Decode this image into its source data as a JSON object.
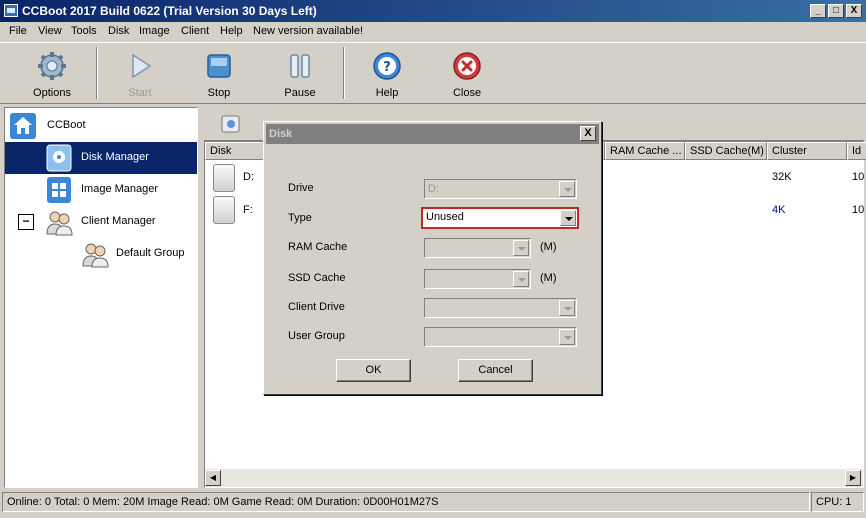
{
  "window": {
    "title": "CCBoot 2017 Build 0622 (Trial Version 30 Days Left)",
    "minimize": "_",
    "maximize": "□",
    "close": "X"
  },
  "menu": [
    "File",
    "View",
    "Tools",
    "Disk",
    "Image",
    "Client",
    "Help",
    "New version available!"
  ],
  "toolbar": {
    "options": "Options",
    "start": "Start",
    "stop": "Stop",
    "pause": "Pause",
    "help": "Help",
    "close": "Close"
  },
  "tree": {
    "root": "CCBoot",
    "disk_manager": "Disk Manager",
    "image_manager": "Image Manager",
    "client_manager": "Client Manager",
    "default_group": "Default Group",
    "expander": "−"
  },
  "grid": {
    "columns": [
      "Disk",
      "RAM Cache ...",
      "SSD Cache(M)",
      "Cluster",
      "Id"
    ],
    "rows": [
      {
        "disk": "D:",
        "cluster": "32K",
        "id": "10"
      },
      {
        "disk": "F:",
        "cluster": "4K",
        "id": "10"
      }
    ]
  },
  "status": {
    "main": "Online: 0 Total: 0 Mem: 20M Image Read: 0M Game Read: 0M Duration: 0D00H01M27S",
    "cpu": "CPU: 1"
  },
  "dialog": {
    "title": "Disk",
    "close": "X",
    "fields": {
      "drive": {
        "label": "Drive",
        "value": "D:"
      },
      "type": {
        "label": "Type",
        "value": "Unused"
      },
      "ram_cache": {
        "label": "RAM Cache",
        "value": "",
        "unit": "(M)"
      },
      "ssd_cache": {
        "label": "SSD Cache",
        "value": "",
        "unit": "(M)"
      },
      "client_drive": {
        "label": "Client Drive",
        "value": ""
      },
      "user_group": {
        "label": "User Group",
        "value": ""
      }
    },
    "ok": "OK",
    "cancel": "Cancel"
  },
  "colors": {
    "accent_selection": "#0a246a",
    "highlight_border": "#c0282a",
    "cluster_blue": "#0000c0"
  }
}
